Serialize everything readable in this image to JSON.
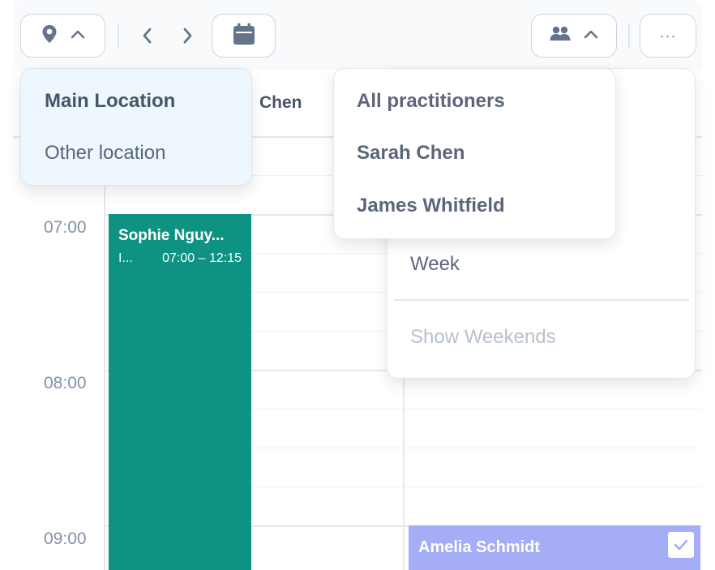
{
  "toolbar": {
    "location_icon": "map-pin-icon",
    "location_chevron": "chevron-up-icon",
    "prev_icon": "chevron-left-icon",
    "next_icon": "chevron-right-icon",
    "calendar_icon": "calendar-icon",
    "practitioners_icon": "users-icon",
    "practitioners_chevron": "chevron-up-icon",
    "more_icon": "ellipsis-icon",
    "more_label": "···"
  },
  "columns": {
    "practitioner_header": "Chen"
  },
  "time_labels": [
    "07:00",
    "08:00",
    "09:00"
  ],
  "events": [
    {
      "name": "Sophie Nguy...",
      "detail": "I...",
      "time": "07:00 – 12:15",
      "color": "#0e9282"
    },
    {
      "name": "Amelia Schmidt",
      "color": "#a5adf7",
      "checked": true
    }
  ],
  "location_menu": {
    "items": [
      {
        "label": "Main Location",
        "selected": true
      },
      {
        "label": "Other location",
        "selected": false
      }
    ]
  },
  "practitioner_menu": {
    "items": [
      {
        "label": "All practitioners"
      },
      {
        "label": "Sarah Chen"
      },
      {
        "label": "James Whitfield"
      }
    ]
  },
  "view_menu": {
    "items": [
      {
        "label": "Week"
      },
      {
        "label": "Show Weekends",
        "disabled": true
      }
    ]
  },
  "colors": {
    "accent_green": "#0e9282",
    "accent_purple": "#a5adf7",
    "muted_text": "#8391a7"
  }
}
